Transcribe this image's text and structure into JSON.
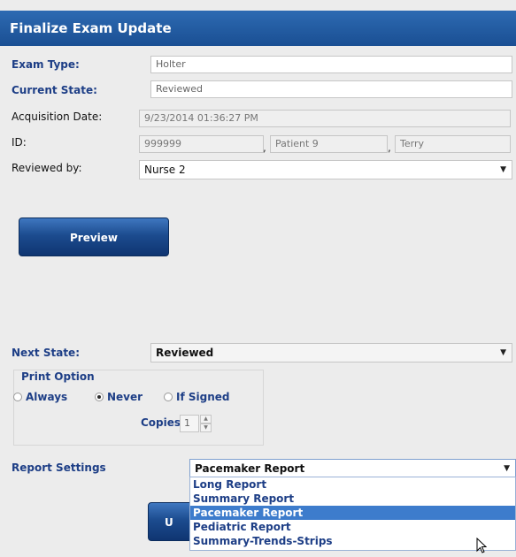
{
  "window": {
    "title": "Finalize Exam Update"
  },
  "form": {
    "exam_type": {
      "label": "Exam Type:",
      "value": "Holter"
    },
    "current_state": {
      "label": "Current State:",
      "value": "Reviewed"
    },
    "acquisition_date": {
      "label": "Acquisition Date:",
      "value": "9/23/2014 01:36:27 PM"
    },
    "id": {
      "label": "ID:",
      "value": "999999",
      "last_name": "Patient 9",
      "first_name": "Terry",
      "separator": ","
    },
    "reviewed_by": {
      "label": "Reviewed by:",
      "value": "Nurse 2"
    }
  },
  "buttons": {
    "preview": "Preview",
    "update_partial": "U"
  },
  "next_state": {
    "label": "Next State:",
    "value": "Reviewed"
  },
  "print_option": {
    "title": "Print Option",
    "options": [
      "Always",
      "Never",
      "If Signed"
    ],
    "selected": "Never",
    "copies_label": "Copies",
    "copies_value": "1"
  },
  "report_settings": {
    "label": "Report Settings",
    "selected": "Pacemaker Report",
    "options": [
      "Long Report",
      "Summary Report",
      "Pacemaker Report",
      "Pediatric Report",
      "Summary-Trends-Strips"
    ]
  },
  "icons": {
    "dropdown_arrow": "▼",
    "spin_up": "▲",
    "spin_down": "▼"
  }
}
